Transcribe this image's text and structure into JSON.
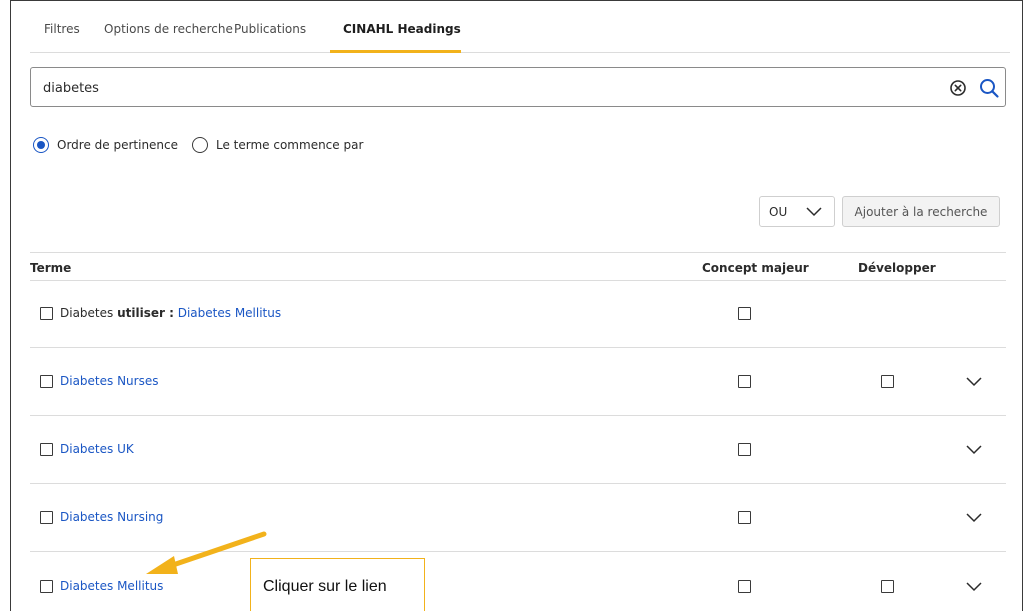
{
  "tabs": [
    {
      "label": "Filtres",
      "active": false
    },
    {
      "label": "Options de recherche",
      "active": false
    },
    {
      "label": "Publications",
      "active": false
    },
    {
      "label": "CINAHL Headings",
      "active": true
    }
  ],
  "search": {
    "value": "diabetes",
    "clear_icon": "clear-circle-x",
    "search_icon": "magnifier"
  },
  "sort_options": [
    {
      "label": "Ordre de pertinence",
      "selected": true
    },
    {
      "label": "Le terme commence par",
      "selected": false
    }
  ],
  "boolean_select": {
    "value": "OU"
  },
  "add_button": {
    "label": "Ajouter à la recherche"
  },
  "table": {
    "headers": {
      "term": "Terme",
      "major": "Concept majeur",
      "explode": "Développer"
    },
    "rows": [
      {
        "prefix": "Diabetes",
        "use_label": "utiliser :",
        "link": "Diabetes Mellitus",
        "has_explode": false,
        "has_chevron": false
      },
      {
        "prefix": "",
        "use_label": "",
        "link": "Diabetes Nurses",
        "has_explode": true,
        "has_chevron": true
      },
      {
        "prefix": "",
        "use_label": "",
        "link": "Diabetes UK",
        "has_explode": false,
        "has_chevron": true
      },
      {
        "prefix": "",
        "use_label": "",
        "link": "Diabetes Nursing",
        "has_explode": false,
        "has_chevron": true
      },
      {
        "prefix": "",
        "use_label": "",
        "link": "Diabetes Mellitus",
        "has_explode": true,
        "has_chevron": true
      }
    ]
  },
  "annotation": {
    "text": "Cliquer sur le lien"
  },
  "colors": {
    "accent": "#f2b21b",
    "link": "#1a56c4",
    "radio_selected": "#1a56c4"
  }
}
